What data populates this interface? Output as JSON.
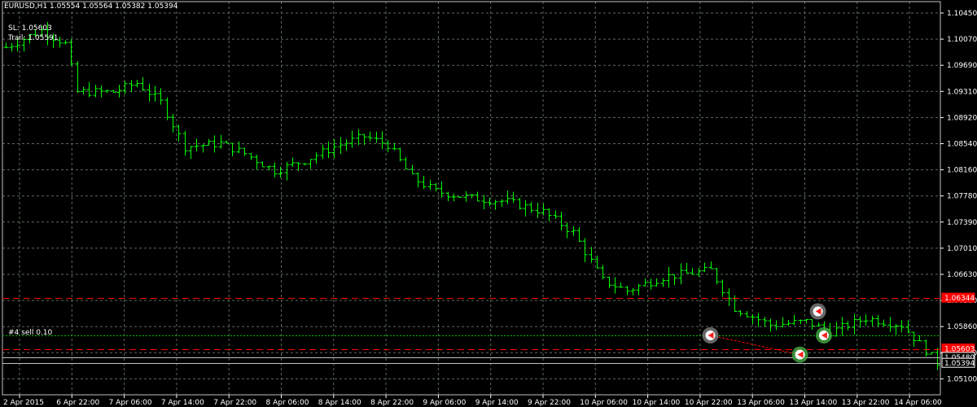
{
  "header": {
    "title": "EURUSD,H1",
    "ohlc": "1.05554 1.05564 1.05382 1.05394"
  },
  "info": {
    "sl_label": "SL: 1.05603",
    "trail_label": "Trail: 1.05591"
  },
  "order_label": "#4 sell 0.10",
  "colors": {
    "background": "#000000",
    "grid": "#5a6b5a",
    "candle": "#00ff00",
    "stop_line": "#ff0000",
    "order_line": "#00c000",
    "price_line": "#c0c0c0",
    "marker_ring": "#808080",
    "marker_ring_active": "#44aa44",
    "marker_arrow": "#ff2020"
  },
  "chart_data": {
    "type": "candlestick",
    "symbol": "EURUSD",
    "timeframe": "H1",
    "ylim": [
      1.05,
      1.105
    ],
    "y_ticks": [
      "1.10450",
      "1.10070",
      "1.09690",
      "1.09310",
      "1.08920",
      "1.08540",
      "1.08160",
      "1.07780",
      "1.07390",
      "1.07010",
      "1.06630",
      "1.06250",
      "1.05860",
      "1.05480",
      "1.05100"
    ],
    "x_ticks": [
      "2 Apr 2015",
      "6 Apr 22:00",
      "7 Apr 06:00",
      "7 Apr 14:00",
      "7 Apr 22:00",
      "8 Apr 06:00",
      "8 Apr 14:00",
      "8 Apr 22:00",
      "9 Apr 06:00",
      "9 Apr 14:00",
      "9 Apr 22:00",
      "10 Apr 06:00",
      "10 Apr 14:00",
      "10 Apr 22:00",
      "13 Apr 06:00",
      "13 Apr 14:00",
      "13 Apr 22:00",
      "14 Apr 06:00"
    ],
    "bars_count": 157,
    "anchors": [
      [
        0,
        1.1
      ],
      [
        6,
        1.1025
      ],
      [
        10,
        1.1005
      ],
      [
        12,
        1.0935
      ],
      [
        18,
        1.0935
      ],
      [
        22,
        1.0948
      ],
      [
        26,
        1.092
      ],
      [
        30,
        1.0855
      ],
      [
        36,
        1.086
      ],
      [
        40,
        1.0845
      ],
      [
        45,
        1.082
      ],
      [
        50,
        1.0835
      ],
      [
        55,
        1.0855
      ],
      [
        60,
        1.087
      ],
      [
        64,
        1.0858
      ],
      [
        68,
        1.081
      ],
      [
        72,
        1.079
      ],
      [
        78,
        1.078
      ],
      [
        84,
        1.0775
      ],
      [
        90,
        1.076
      ],
      [
        95,
        1.073
      ],
      [
        100,
        1.066
      ],
      [
        104,
        1.0645
      ],
      [
        110,
        1.0665
      ],
      [
        118,
        1.0675
      ],
      [
        122,
        1.062
      ],
      [
        128,
        1.0595
      ],
      [
        134,
        1.06
      ],
      [
        138,
        1.0585
      ],
      [
        144,
        1.0605
      ],
      [
        150,
        1.0595
      ],
      [
        156,
        1.054
      ]
    ],
    "price_levels": [
      {
        "name": "stop-line-upper",
        "value": 1.06344,
        "label": "1.06344",
        "style": "dashed",
        "color": "#ff0000"
      },
      {
        "name": "order-line",
        "value": 1.058,
        "label": "",
        "style": "dotted",
        "color": "#00c000"
      },
      {
        "name": "stop-line-lower",
        "value": 1.05603,
        "label": "1.05603",
        "style": "dashed",
        "color": "#ff0000"
      },
      {
        "name": "ask-line",
        "value": 1.0548,
        "label": "1.05480",
        "style": "solid",
        "color": "#c0c0c0"
      },
      {
        "name": "current-price-line",
        "value": 1.05394,
        "label": "1.05394",
        "style": "solid",
        "color": "#c0c0c0"
      }
    ],
    "markers": [
      {
        "name": "trade-marker-sell",
        "bar": 118,
        "price": 1.058,
        "active": false
      },
      {
        "name": "trade-marker-close-1",
        "bar": 133,
        "price": 1.0552,
        "active": true
      },
      {
        "name": "trade-marker-close-2",
        "bar": 136,
        "price": 1.0615,
        "active": false
      },
      {
        "name": "trade-marker-close-3",
        "bar": 137,
        "price": 1.058,
        "active": true
      }
    ]
  }
}
